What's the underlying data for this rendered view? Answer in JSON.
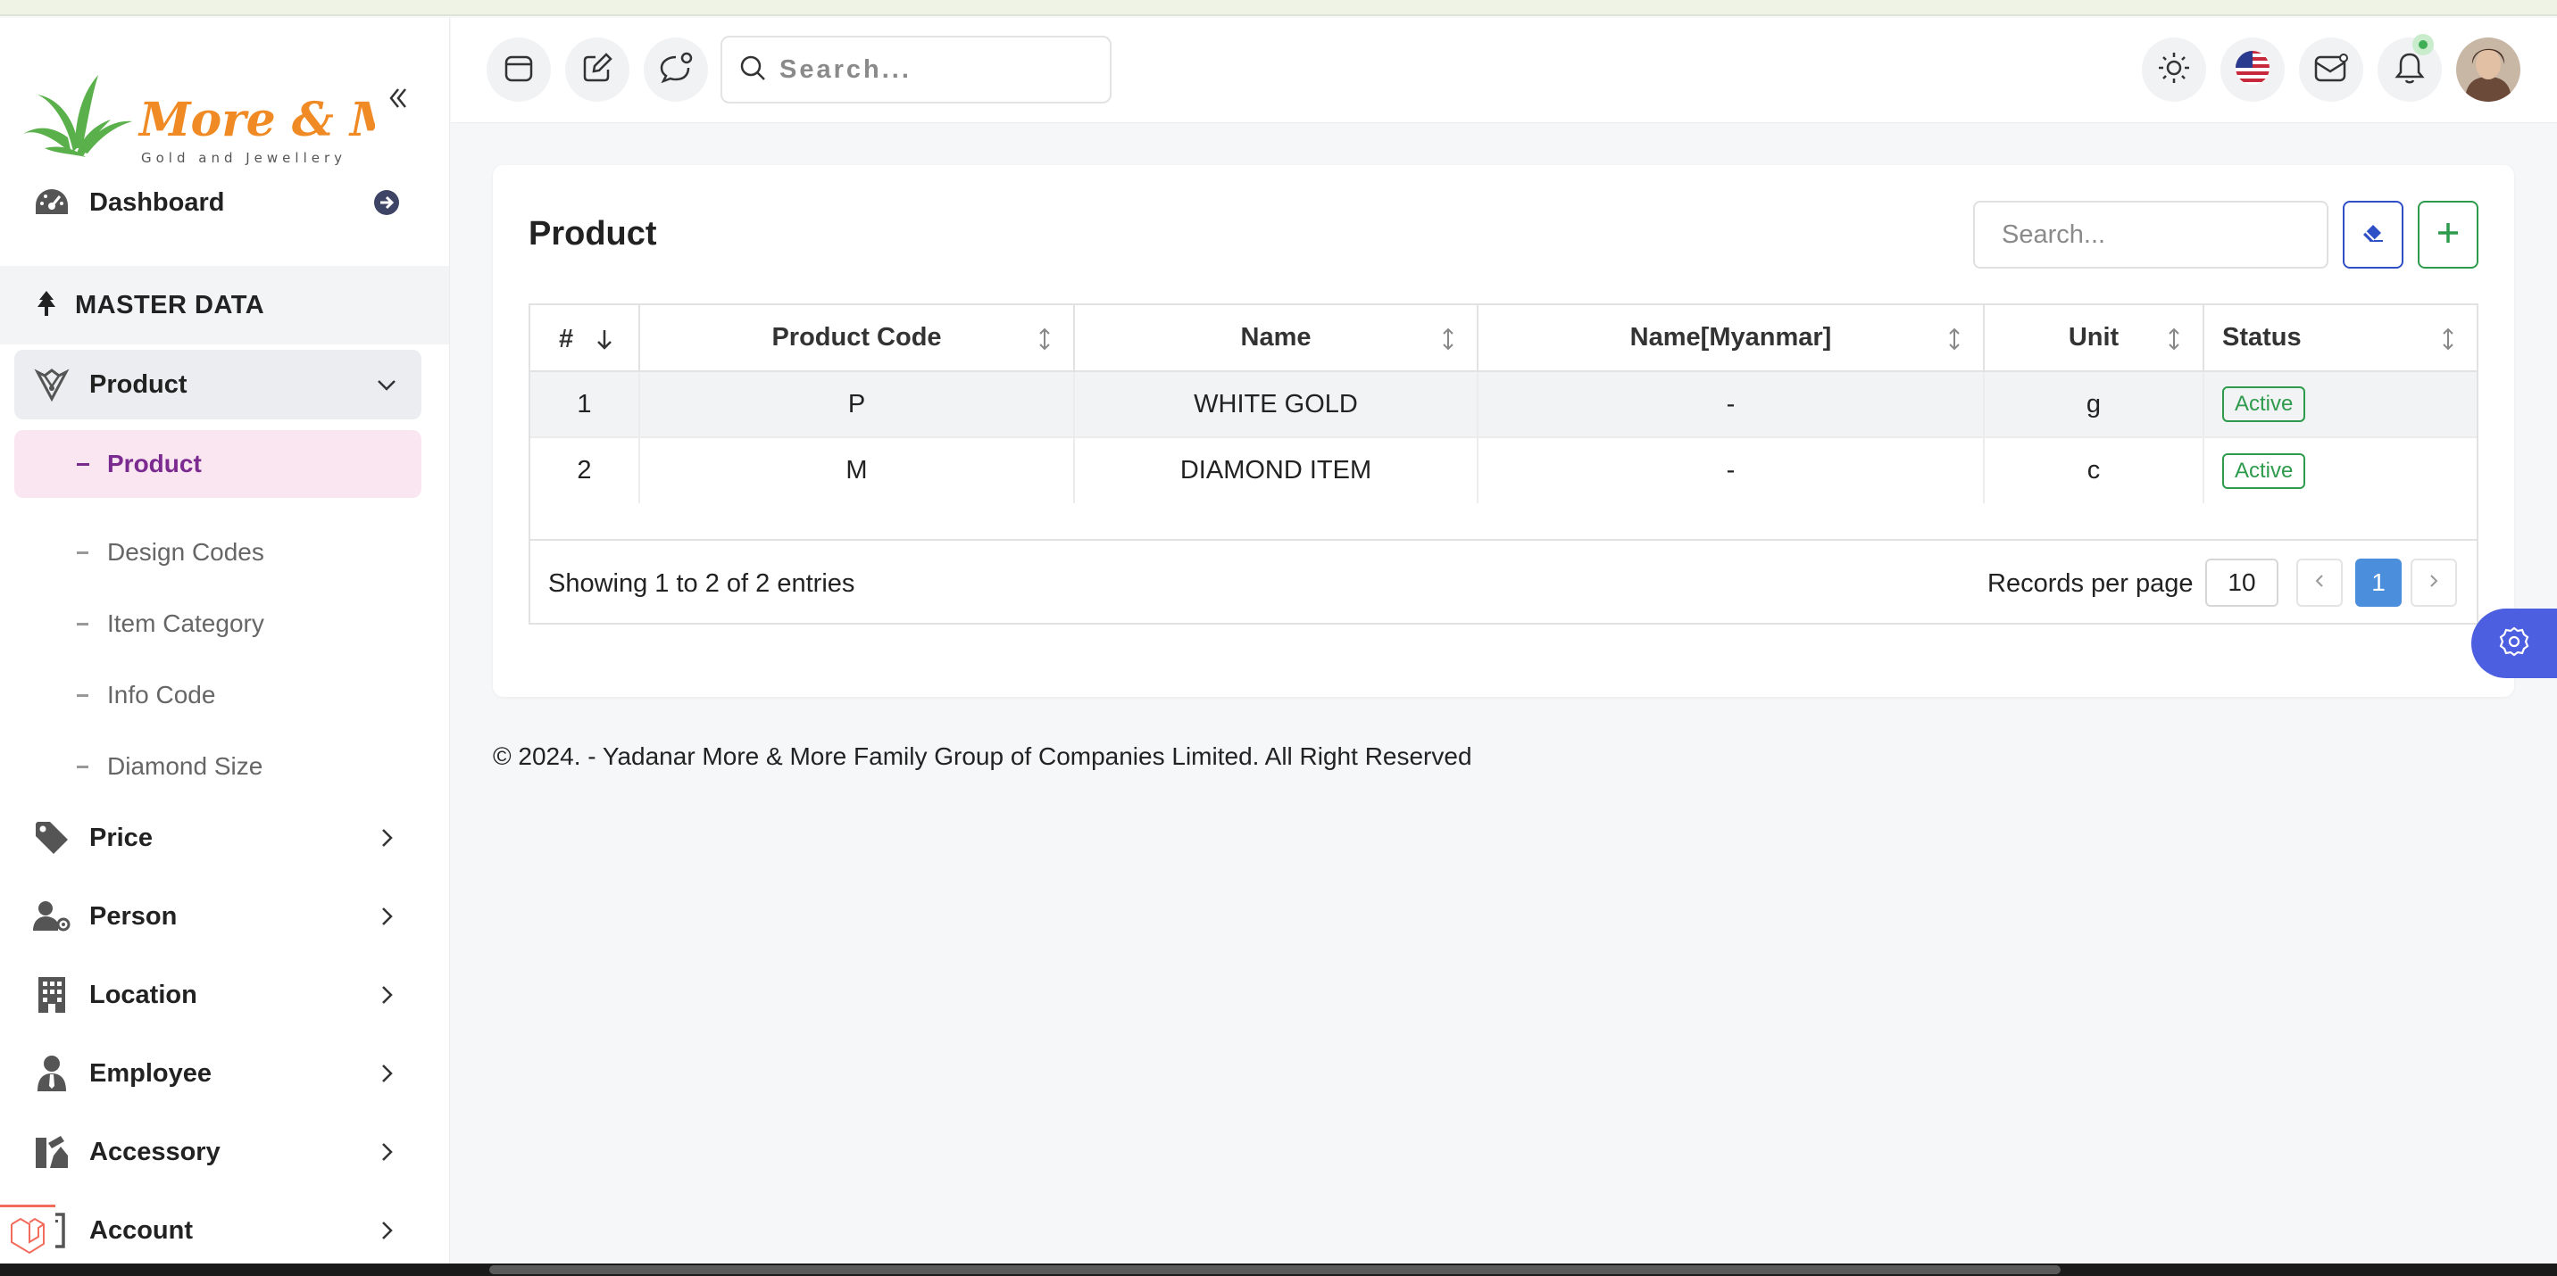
{
  "brand": {
    "name": "More & More",
    "tagline": "Gold and Jewellery",
    "colors": {
      "leaf": "#5ab04a",
      "text": "#f08a24"
    }
  },
  "sidebar": {
    "collapse_icon": "double-chevron-left-icon",
    "dashboard": {
      "label": "Dashboard",
      "icon": "speedometer-icon"
    },
    "section": {
      "label": "MASTER DATA",
      "icon": "tree-icon"
    },
    "product_group": {
      "label": "Product",
      "icon": "gem-icon",
      "expanded": true,
      "children": [
        {
          "label": "Product",
          "active": true
        },
        {
          "label": "Design Codes"
        },
        {
          "label": "Item Category"
        },
        {
          "label": "Info Code"
        },
        {
          "label": "Diamond Size"
        }
      ]
    },
    "groups": [
      {
        "label": "Price",
        "icon": "tag-icon"
      },
      {
        "label": "Person",
        "icon": "user-gear-icon"
      },
      {
        "label": "Location",
        "icon": "building-icon"
      },
      {
        "label": "Employee",
        "icon": "user-tie-icon"
      },
      {
        "label": "Accessory",
        "icon": "tools-icon"
      },
      {
        "label": "Account",
        "icon": "book-icon"
      }
    ]
  },
  "header": {
    "search_placeholder": "Search...",
    "icons": [
      "calendar-icon",
      "edit-icon",
      "chat-icon",
      "sun-icon",
      "us-flag-icon",
      "mail-icon",
      "bell-icon",
      "avatar"
    ]
  },
  "card": {
    "title": "Product",
    "search_placeholder": "Search...",
    "columns": [
      "#",
      "Product Code",
      "Name",
      "Name[Myanmar]",
      "Unit",
      "Status"
    ],
    "rows": [
      {
        "no": "1",
        "code": "P",
        "name": "WHITE GOLD",
        "name_mm": "-",
        "unit": "g",
        "status": "Active"
      },
      {
        "no": "2",
        "code": "M",
        "name": "DIAMOND ITEM",
        "name_mm": "-",
        "unit": "c",
        "status": "Active"
      }
    ],
    "showing": "Showing 1 to 2 of 2 entries",
    "records_per_page_label": "Records per page",
    "records_per_page": "10",
    "current_page": "1",
    "status_color": "#2e9b4c",
    "accent_color": "#4b8fdc"
  },
  "footer": {
    "copyright": "© 2024. - Yadanar More & More Family Group of Companies Limited. All Right Reserved"
  }
}
